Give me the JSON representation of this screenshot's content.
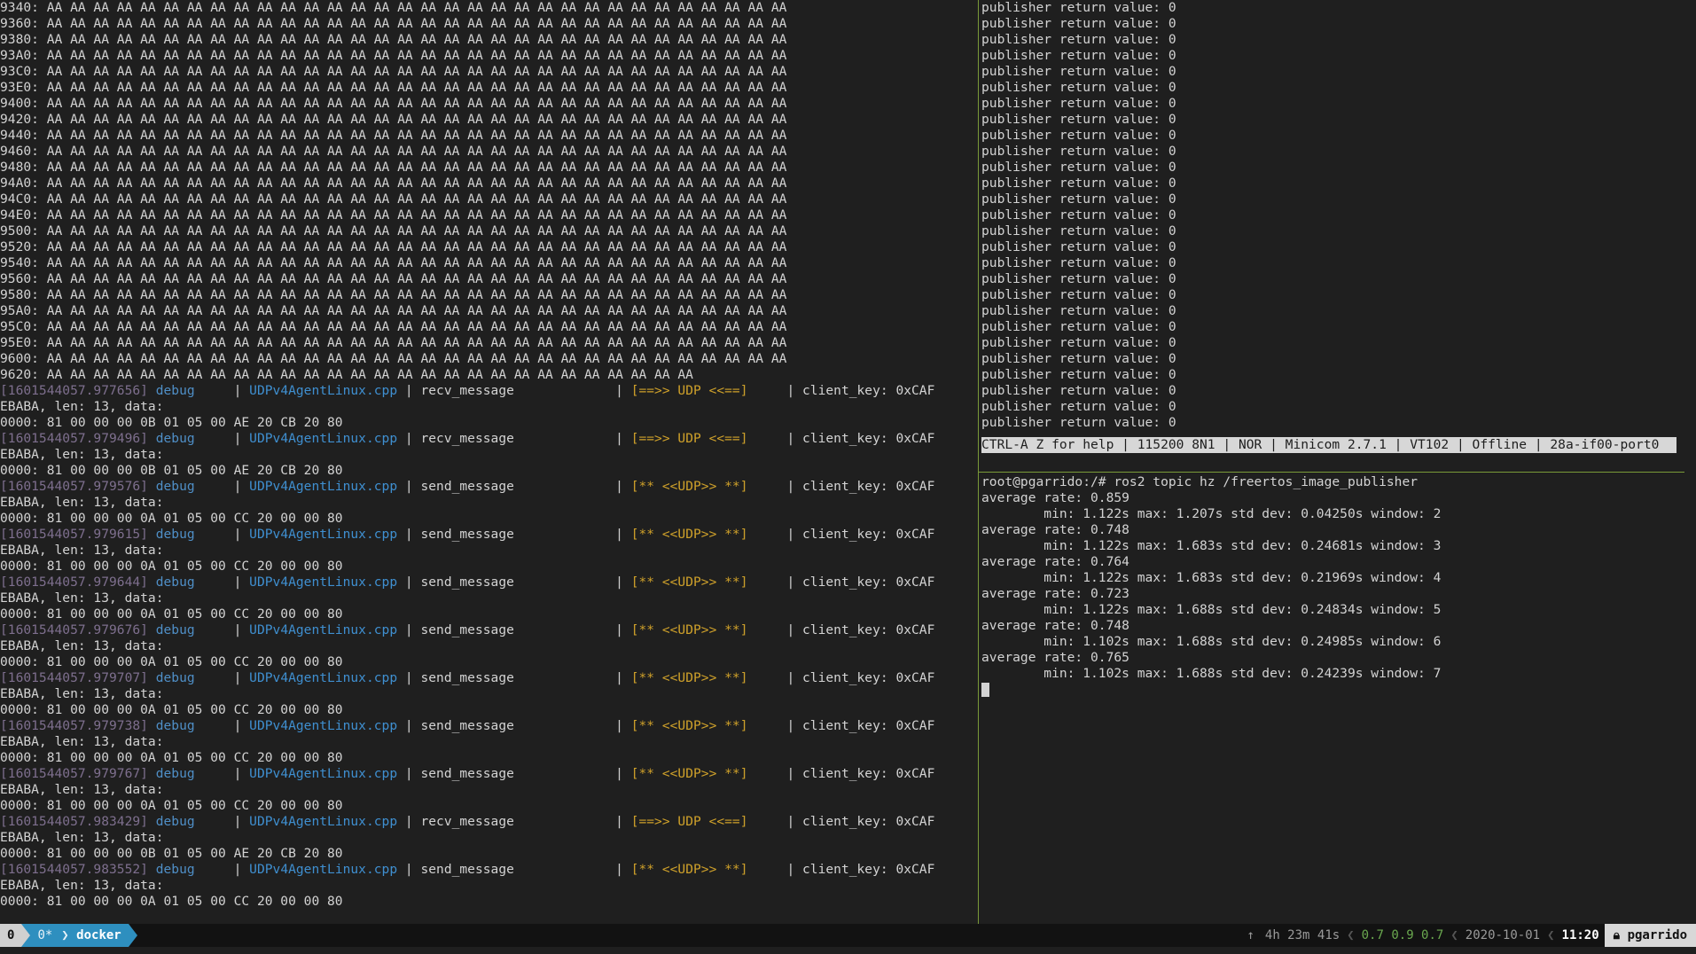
{
  "left_pane": {
    "hex_rows": [
      "9340: AA AA AA AA AA AA AA AA AA AA AA AA AA AA AA AA AA AA AA AA AA AA AA AA AA AA AA AA AA AA AA AA",
      "9360: AA AA AA AA AA AA AA AA AA AA AA AA AA AA AA AA AA AA AA AA AA AA AA AA AA AA AA AA AA AA AA AA",
      "9380: AA AA AA AA AA AA AA AA AA AA AA AA AA AA AA AA AA AA AA AA AA AA AA AA AA AA AA AA AA AA AA AA",
      "93A0: AA AA AA AA AA AA AA AA AA AA AA AA AA AA AA AA AA AA AA AA AA AA AA AA AA AA AA AA AA AA AA AA",
      "93C0: AA AA AA AA AA AA AA AA AA AA AA AA AA AA AA AA AA AA AA AA AA AA AA AA AA AA AA AA AA AA AA AA",
      "93E0: AA AA AA AA AA AA AA AA AA AA AA AA AA AA AA AA AA AA AA AA AA AA AA AA AA AA AA AA AA AA AA AA",
      "9400: AA AA AA AA AA AA AA AA AA AA AA AA AA AA AA AA AA AA AA AA AA AA AA AA AA AA AA AA AA AA AA AA",
      "9420: AA AA AA AA AA AA AA AA AA AA AA AA AA AA AA AA AA AA AA AA AA AA AA AA AA AA AA AA AA AA AA AA",
      "9440: AA AA AA AA AA AA AA AA AA AA AA AA AA AA AA AA AA AA AA AA AA AA AA AA AA AA AA AA AA AA AA AA",
      "9460: AA AA AA AA AA AA AA AA AA AA AA AA AA AA AA AA AA AA AA AA AA AA AA AA AA AA AA AA AA AA AA AA",
      "9480: AA AA AA AA AA AA AA AA AA AA AA AA AA AA AA AA AA AA AA AA AA AA AA AA AA AA AA AA AA AA AA AA",
      "94A0: AA AA AA AA AA AA AA AA AA AA AA AA AA AA AA AA AA AA AA AA AA AA AA AA AA AA AA AA AA AA AA AA",
      "94C0: AA AA AA AA AA AA AA AA AA AA AA AA AA AA AA AA AA AA AA AA AA AA AA AA AA AA AA AA AA AA AA AA",
      "94E0: AA AA AA AA AA AA AA AA AA AA AA AA AA AA AA AA AA AA AA AA AA AA AA AA AA AA AA AA AA AA AA AA",
      "9500: AA AA AA AA AA AA AA AA AA AA AA AA AA AA AA AA AA AA AA AA AA AA AA AA AA AA AA AA AA AA AA AA",
      "9520: AA AA AA AA AA AA AA AA AA AA AA AA AA AA AA AA AA AA AA AA AA AA AA AA AA AA AA AA AA AA AA AA",
      "9540: AA AA AA AA AA AA AA AA AA AA AA AA AA AA AA AA AA AA AA AA AA AA AA AA AA AA AA AA AA AA AA AA",
      "9560: AA AA AA AA AA AA AA AA AA AA AA AA AA AA AA AA AA AA AA AA AA AA AA AA AA AA AA AA AA AA AA AA",
      "9580: AA AA AA AA AA AA AA AA AA AA AA AA AA AA AA AA AA AA AA AA AA AA AA AA AA AA AA AA AA AA AA AA",
      "95A0: AA AA AA AA AA AA AA AA AA AA AA AA AA AA AA AA AA AA AA AA AA AA AA AA AA AA AA AA AA AA AA AA",
      "95C0: AA AA AA AA AA AA AA AA AA AA AA AA AA AA AA AA AA AA AA AA AA AA AA AA AA AA AA AA AA AA AA AA",
      "95E0: AA AA AA AA AA AA AA AA AA AA AA AA AA AA AA AA AA AA AA AA AA AA AA AA AA AA AA AA AA AA AA AA",
      "9600: AA AA AA AA AA AA AA AA AA AA AA AA AA AA AA AA AA AA AA AA AA AA AA AA AA AA AA AA AA AA AA AA",
      "9620: AA AA AA AA AA AA AA AA AA AA AA AA AA AA AA AA AA AA AA AA AA AA AA AA AA AA AA AA"
    ],
    "log_entries": [
      {
        "timestamp": "[1601544057.977656]",
        "level": "debug",
        "file": "UDPv4AgentLinux.cpp",
        "function": "recv_message",
        "direction": "[==>> UDP <<==]",
        "client_key": "client_key: 0xCAF",
        "cont": "EBABA, len: 13, data:",
        "data": "0000: 81 00 00 00 0B 01 05 00 AE 20 CB 20 80"
      },
      {
        "timestamp": "[1601544057.979496]",
        "level": "debug",
        "file": "UDPv4AgentLinux.cpp",
        "function": "recv_message",
        "direction": "[==>> UDP <<==]",
        "client_key": "client_key: 0xCAF",
        "cont": "EBABA, len: 13, data:",
        "data": "0000: 81 00 00 00 0B 01 05 00 AE 20 CB 20 80"
      },
      {
        "timestamp": "[1601544057.979576]",
        "level": "debug",
        "file": "UDPv4AgentLinux.cpp",
        "function": "send_message",
        "direction": "[** <<UDP>> **]",
        "client_key": "client_key: 0xCAF",
        "cont": "EBABA, len: 13, data:",
        "data": "0000: 81 00 00 00 0A 01 05 00 CC 20 00 00 80"
      },
      {
        "timestamp": "[1601544057.979615]",
        "level": "debug",
        "file": "UDPv4AgentLinux.cpp",
        "function": "send_message",
        "direction": "[** <<UDP>> **]",
        "client_key": "client_key: 0xCAF",
        "cont": "EBABA, len: 13, data:",
        "data": "0000: 81 00 00 00 0A 01 05 00 CC 20 00 00 80"
      },
      {
        "timestamp": "[1601544057.979644]",
        "level": "debug",
        "file": "UDPv4AgentLinux.cpp",
        "function": "send_message",
        "direction": "[** <<UDP>> **]",
        "client_key": "client_key: 0xCAF",
        "cont": "EBABA, len: 13, data:",
        "data": "0000: 81 00 00 00 0A 01 05 00 CC 20 00 00 80"
      },
      {
        "timestamp": "[1601544057.979676]",
        "level": "debug",
        "file": "UDPv4AgentLinux.cpp",
        "function": "send_message",
        "direction": "[** <<UDP>> **]",
        "client_key": "client_key: 0xCAF",
        "cont": "EBABA, len: 13, data:",
        "data": "0000: 81 00 00 00 0A 01 05 00 CC 20 00 00 80"
      },
      {
        "timestamp": "[1601544057.979707]",
        "level": "debug",
        "file": "UDPv4AgentLinux.cpp",
        "function": "send_message",
        "direction": "[** <<UDP>> **]",
        "client_key": "client_key: 0xCAF",
        "cont": "EBABA, len: 13, data:",
        "data": "0000: 81 00 00 00 0A 01 05 00 CC 20 00 00 80"
      },
      {
        "timestamp": "[1601544057.979738]",
        "level": "debug",
        "file": "UDPv4AgentLinux.cpp",
        "function": "send_message",
        "direction": "[** <<UDP>> **]",
        "client_key": "client_key: 0xCAF",
        "cont": "EBABA, len: 13, data:",
        "data": "0000: 81 00 00 00 0A 01 05 00 CC 20 00 00 80"
      },
      {
        "timestamp": "[1601544057.979767]",
        "level": "debug",
        "file": "UDPv4AgentLinux.cpp",
        "function": "send_message",
        "direction": "[** <<UDP>> **]",
        "client_key": "client_key: 0xCAF",
        "cont": "EBABA, len: 13, data:",
        "data": "0000: 81 00 00 00 0A 01 05 00 CC 20 00 00 80"
      },
      {
        "timestamp": "[1601544057.983429]",
        "level": "debug",
        "file": "UDPv4AgentLinux.cpp",
        "function": "recv_message",
        "direction": "[==>> UDP <<==]",
        "client_key": "client_key: 0xCAF",
        "cont": "EBABA, len: 13, data:",
        "data": "0000: 81 00 00 00 0B 01 05 00 AE 20 CB 20 80"
      },
      {
        "timestamp": "[1601544057.983552]",
        "level": "debug",
        "file": "UDPv4AgentLinux.cpp",
        "function": "send_message",
        "direction": "[** <<UDP>> **]",
        "client_key": "client_key: 0xCAF",
        "cont": "EBABA, len: 13, data:",
        "data": "0000: 81 00 00 00 0A 01 05 00 CC 20 00 00 80"
      }
    ]
  },
  "right_top_pane": {
    "publisher_line": "publisher return value: 0",
    "publisher_line_count": 27,
    "minicom_status": "CTRL-A Z for help | 115200 8N1 | NOR | Minicom 2.7.1 | VT102 | Offline | 28a-if00-port0"
  },
  "right_bottom_pane": {
    "command_line": "root@pgarrido:/# ros2 topic hz /freertos_image_publisher",
    "stats": [
      {
        "avg": "average rate: 0.859",
        "detail": "        min: 1.122s max: 1.207s std dev: 0.04250s window: 2"
      },
      {
        "avg": "average rate: 0.748",
        "detail": "        min: 1.122s max: 1.683s std dev: 0.24681s window: 3"
      },
      {
        "avg": "average rate: 0.764",
        "detail": "        min: 1.122s max: 1.683s std dev: 0.21969s window: 4"
      },
      {
        "avg": "average rate: 0.723",
        "detail": "        min: 1.122s max: 1.688s std dev: 0.24834s window: 5"
      },
      {
        "avg": "average rate: 0.748",
        "detail": "        min: 1.102s max: 1.688s std dev: 0.24985s window: 6"
      },
      {
        "avg": "average rate: 0.765",
        "detail": "        min: 1.102s max: 1.688s std dev: 0.24239s window: 7"
      }
    ]
  },
  "statusbar": {
    "session": "0",
    "window_inactive": "0*",
    "window_active": "docker",
    "uptime_icon": "up-arrow-icon",
    "uptime_glyph": "↑",
    "uptime": "4h 23m 41s",
    "separator_glyph": "❮",
    "load": "0.7 0.9 0.7",
    "date": "2020-10-01",
    "time": "11:20",
    "lock_icon": "lock-icon",
    "user": "pgarrido"
  },
  "colors": {
    "background": "#1f1f1f",
    "timestamp": "#7e6f8e",
    "file": "#3f8fd0",
    "udp_direction": "#cfa12a",
    "pane_divider": "#7a9a38",
    "tmux_window": "#2e8fbf",
    "load": "#6aa84f"
  }
}
